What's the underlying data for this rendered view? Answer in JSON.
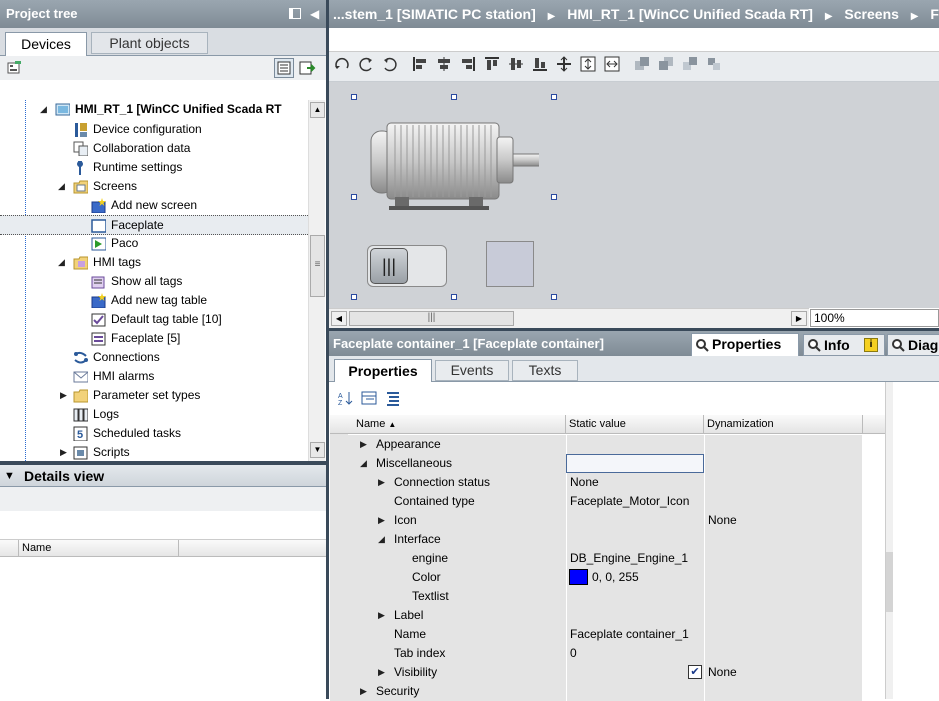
{
  "project_tree": {
    "title": "Project tree",
    "tabs": [
      {
        "label": "Devices"
      },
      {
        "label": "Plant objects"
      }
    ],
    "items": [
      {
        "label": "HMI_RT_1 [WinCC Unified Scada RT"
      },
      {
        "label": "Device configuration"
      },
      {
        "label": "Collaboration data"
      },
      {
        "label": "Runtime settings"
      },
      {
        "label": "Screens"
      },
      {
        "label": "Add new screen"
      },
      {
        "label": "Faceplate"
      },
      {
        "label": "Paco"
      },
      {
        "label": "HMI tags"
      },
      {
        "label": "Show all tags"
      },
      {
        "label": "Add new tag table"
      },
      {
        "label": "Default tag table [10]"
      },
      {
        "label": "Faceplate [5]"
      },
      {
        "label": "Connections"
      },
      {
        "label": "HMI alarms"
      },
      {
        "label": "Parameter set types"
      },
      {
        "label": "Logs"
      },
      {
        "label": "Scheduled tasks"
      },
      {
        "label": "Scripts"
      }
    ]
  },
  "details_view": {
    "title": "Details view",
    "column_name": "Name"
  },
  "breadcrumb": {
    "items": [
      "...stem_1 [SIMATIC PC station]",
      "HMI_RT_1 [WinCC Unified Scada RT]",
      "Screens",
      "Face"
    ]
  },
  "editor": {
    "zoom": "100%"
  },
  "inspector": {
    "title": "Faceplate container_1 [Faceplate container]",
    "top_tabs": [
      "Properties",
      "Info",
      "Diagn"
    ],
    "sub_tabs": [
      "Properties",
      "Events",
      "Texts"
    ],
    "columns": {
      "name": "Name",
      "static": "Static value",
      "dyn": "Dynamization"
    },
    "rows": [
      {
        "name": "Appearance",
        "static": "",
        "dyn": ""
      },
      {
        "name": "Miscellaneous",
        "static": "",
        "dyn": ""
      },
      {
        "name": "Connection status",
        "static": "None",
        "dyn": ""
      },
      {
        "name": "Contained type",
        "static": "Faceplate_Motor_Icon",
        "dyn": ""
      },
      {
        "name": "Icon",
        "static": "",
        "dyn": "None"
      },
      {
        "name": "Interface",
        "static": "",
        "dyn": ""
      },
      {
        "name": "engine",
        "static": "DB_Engine_Engine_1",
        "dyn": ""
      },
      {
        "name": "Color",
        "static": "0, 0, 255",
        "dyn": ""
      },
      {
        "name": "Textlist",
        "static": "",
        "dyn": ""
      },
      {
        "name": "Label",
        "static": "",
        "dyn": ""
      },
      {
        "name": "Name",
        "static": "Faceplate container_1",
        "dyn": ""
      },
      {
        "name": "Tab index",
        "static": "0",
        "dyn": ""
      },
      {
        "name": "Visibility",
        "static": "",
        "dyn": "None"
      },
      {
        "name": "Security",
        "static": "",
        "dyn": ""
      }
    ],
    "color_swatch": "#0000ff"
  }
}
